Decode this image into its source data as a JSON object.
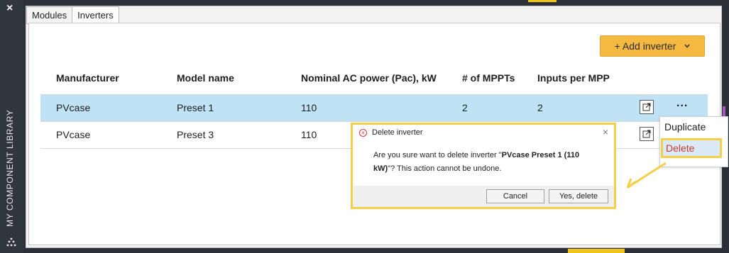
{
  "sidebar": {
    "close_glyph": "×",
    "label": "MY COMPONENT LIBRARY",
    "grip_icon": "grip-icon"
  },
  "tabs": [
    {
      "label": "Modules",
      "active": false
    },
    {
      "label": "Inverters",
      "active": true
    }
  ],
  "toolbar": {
    "add_label": "+ Add inverter",
    "add_chevron": "⌄",
    "accent_color": "#f5b942"
  },
  "table": {
    "columns": [
      "Manufacturer",
      "Model name",
      "Nominal AC power (Pac), kW",
      "# of MPPTs",
      "Inputs per MPP"
    ],
    "rows": [
      {
        "manufacturer": "PVcase",
        "model": "Preset 1",
        "pac": "110",
        "mppts": "2",
        "inputs": "2",
        "selected": true
      },
      {
        "manufacturer": "PVcase",
        "model": "Preset 3",
        "pac": "110",
        "mppts": "",
        "inputs": "",
        "selected": false
      }
    ],
    "row_action_icon": "open-external-icon",
    "more_glyph": "..."
  },
  "context_menu": {
    "items": [
      "Duplicate",
      "Delete"
    ],
    "delete_color": "#c43a2d"
  },
  "dialog": {
    "title": "Delete inverter",
    "message_pre": "Are you sure want to delete inverter \"",
    "message_bold": "PVcase Preset 1 (110 kW)",
    "message_post": "\"? This action cannot be undone.",
    "cancel_label": "Cancel",
    "confirm_label": "Yes, delete",
    "highlight_color": "#f4cf4a"
  }
}
